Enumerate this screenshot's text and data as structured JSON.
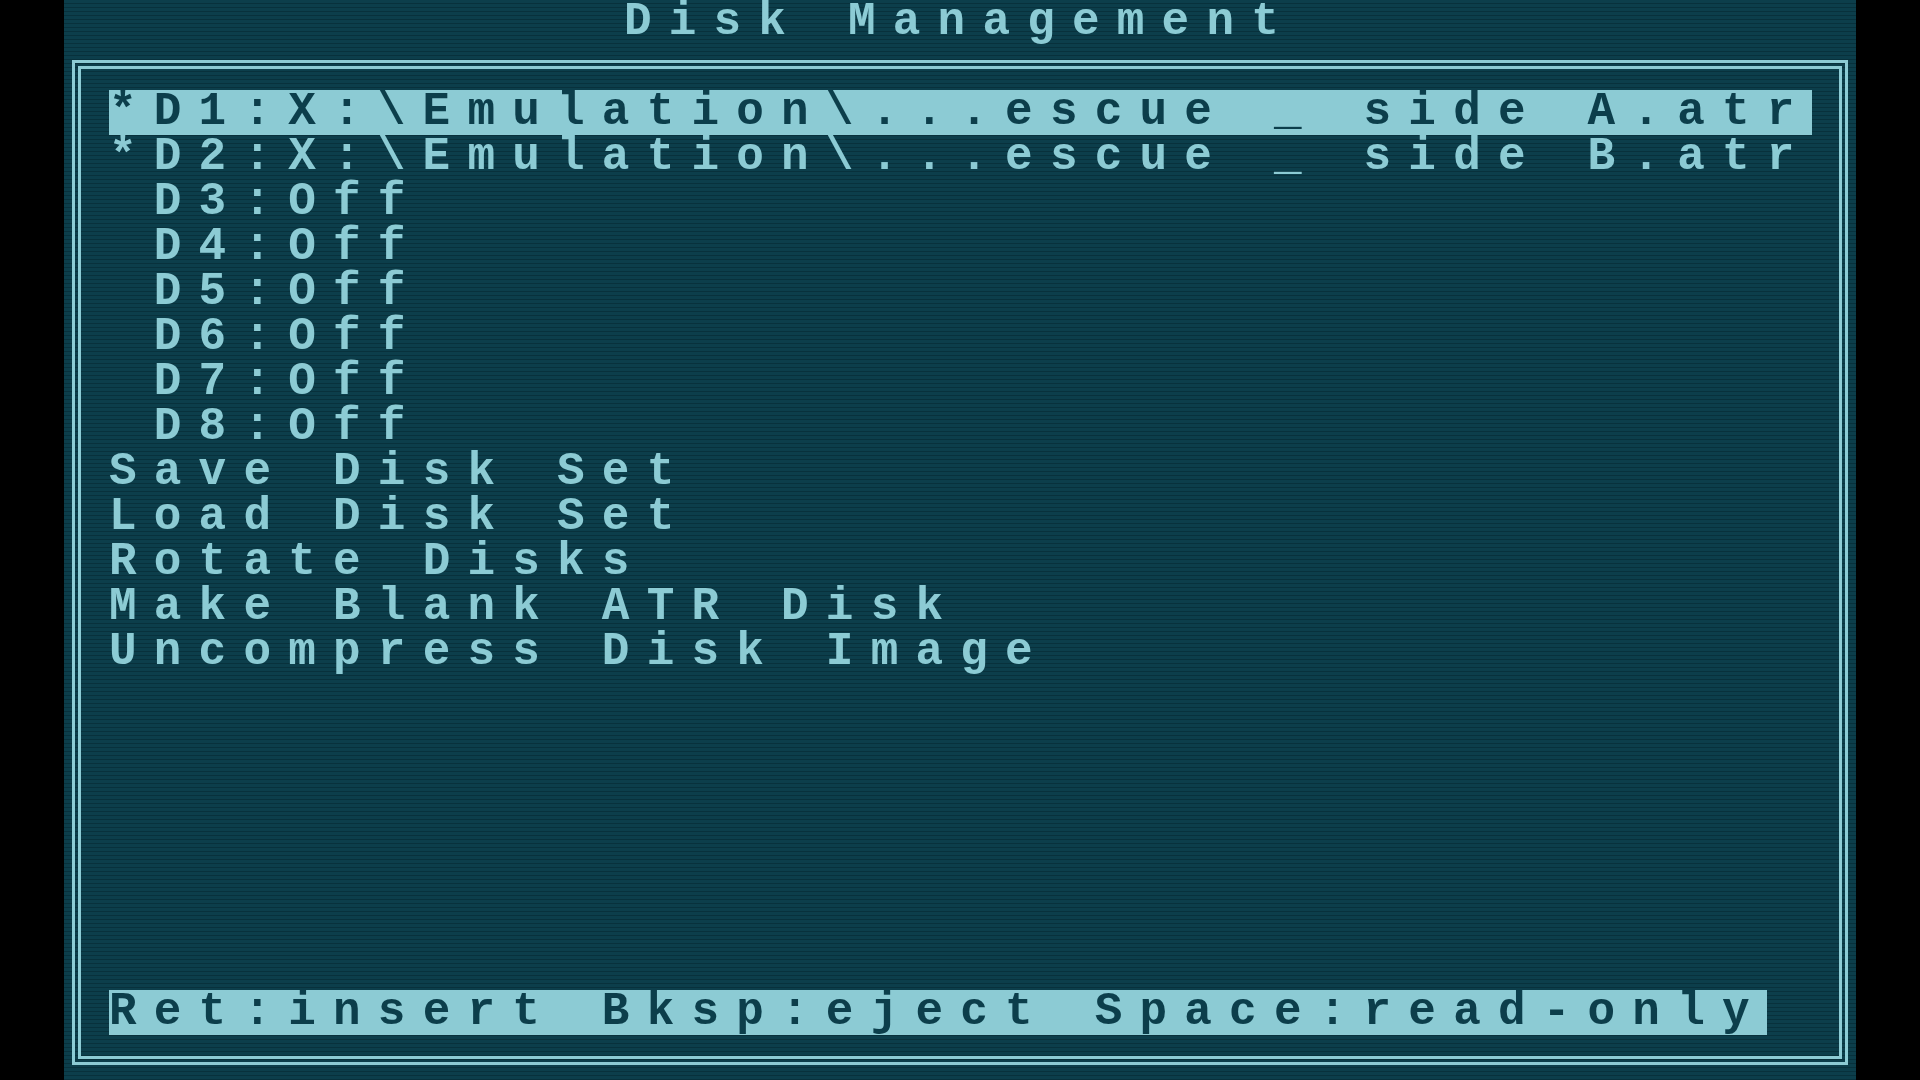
{
  "title": "Disk Management",
  "items": [
    {
      "kind": "drive",
      "marker": "*",
      "label": "D1:X:\\Emulation\\...escue _ side A.atr",
      "selected": true
    },
    {
      "kind": "drive",
      "marker": "*",
      "label": "D2:X:\\Emulation\\...escue _ side B.atr",
      "selected": false
    },
    {
      "kind": "drive",
      "label": "D3:Off",
      "selected": false
    },
    {
      "kind": "drive",
      "label": "D4:Off",
      "selected": false
    },
    {
      "kind": "drive",
      "label": "D5:Off",
      "selected": false
    },
    {
      "kind": "drive",
      "label": "D6:Off",
      "selected": false
    },
    {
      "kind": "drive",
      "label": "D7:Off",
      "selected": false
    },
    {
      "kind": "drive",
      "label": "D8:Off",
      "selected": false
    },
    {
      "kind": "action",
      "label": "Save Disk Set",
      "selected": false
    },
    {
      "kind": "action",
      "label": "Load Disk Set",
      "selected": false
    },
    {
      "kind": "action",
      "label": "Rotate Disks",
      "selected": false
    },
    {
      "kind": "action",
      "label": "Make Blank ATR Disk",
      "selected": false
    },
    {
      "kind": "action",
      "label": "Uncompress Disk Image",
      "selected": false
    }
  ],
  "help_bar": "Ret:insert Bksp:eject Space:read-only"
}
